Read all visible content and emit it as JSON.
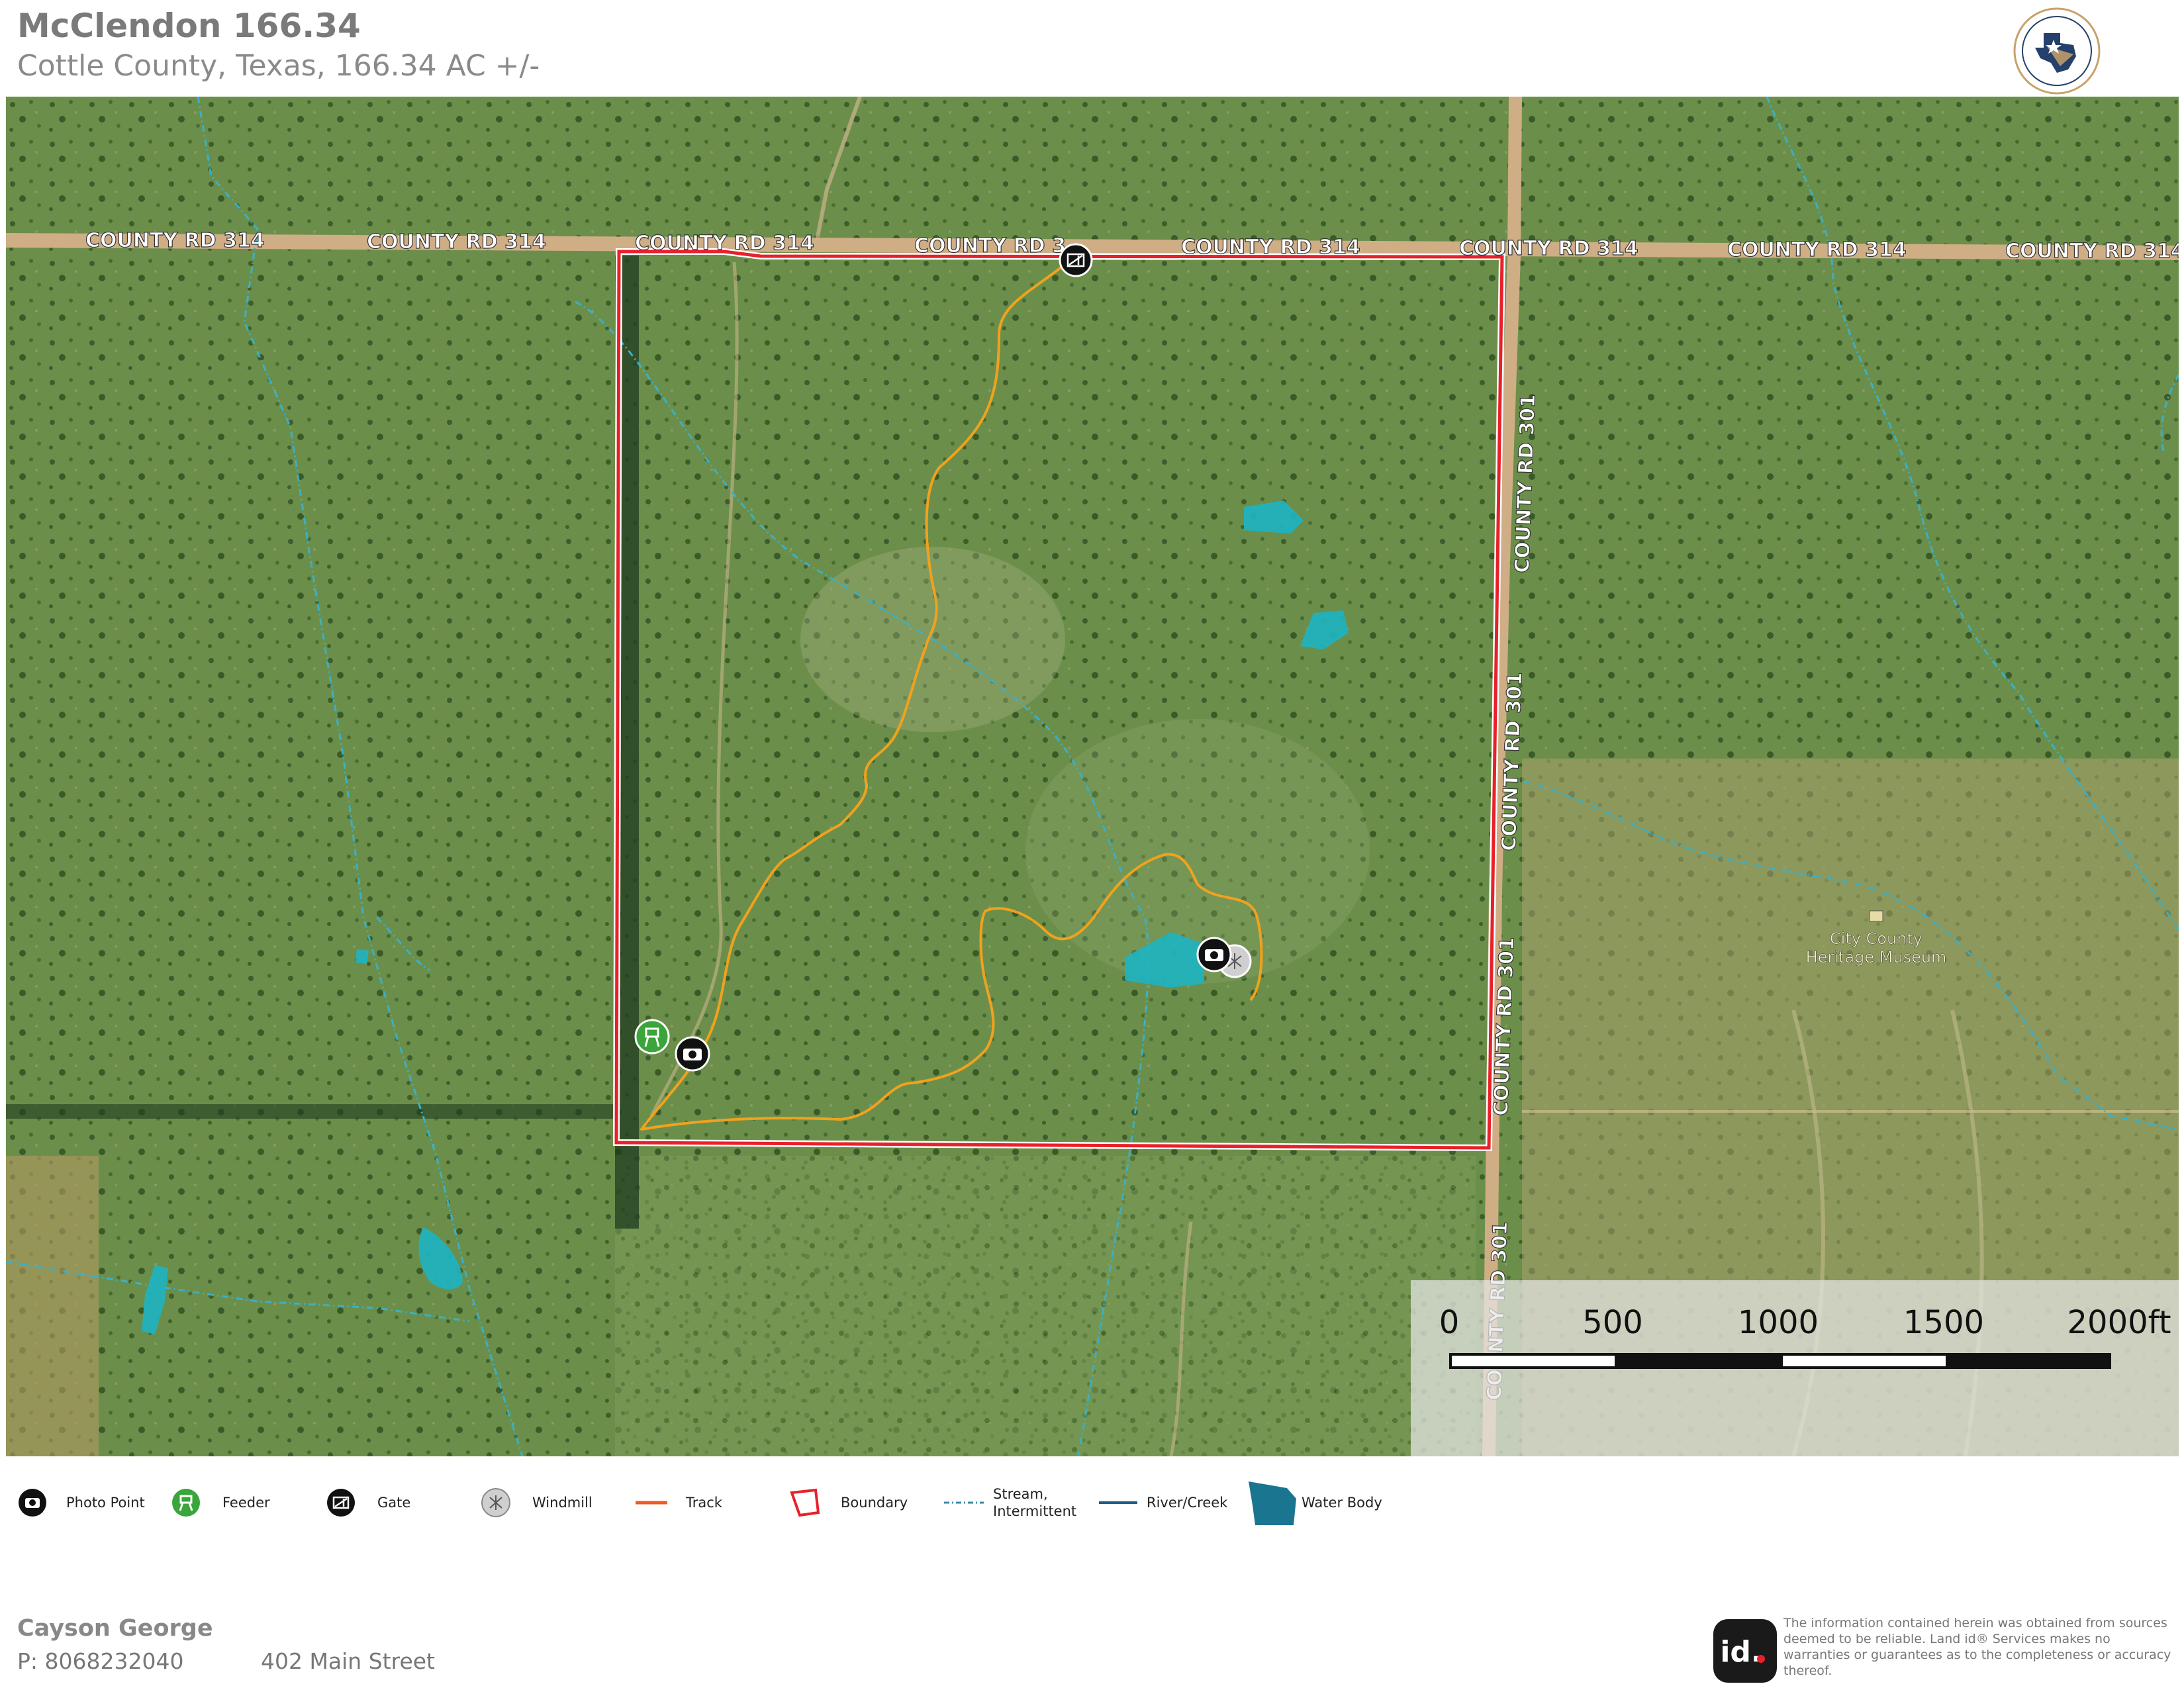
{
  "header": {
    "title": "McClendon 166.34",
    "subtitle": "Cottle County, Texas, 166.34 AC +/-"
  },
  "logo": {
    "name": "western-heritage-logo",
    "text": "WESTERN HERITAGE REALTY & INVESTMENTS"
  },
  "map": {
    "roads": {
      "county_rd_314": "COUNTY RD 314",
      "county_rd_314_partial": "COUNTY RD 3",
      "county_rd_301": "COUNTY RD 301"
    },
    "poi": {
      "museum_line1": "City County",
      "museum_line2": "Heritage Museum"
    },
    "colors": {
      "boundary": "#e8202a",
      "track": "#f0a21e",
      "stream": "#3ab0c8",
      "water": "#1fb3c0",
      "feeder": "#3aa53a"
    }
  },
  "scale_bar": {
    "labels": [
      "0",
      "500",
      "1000",
      "1500",
      "2000ft"
    ]
  },
  "legend": {
    "photo_point": "Photo Point",
    "feeder": "Feeder",
    "gate": "Gate",
    "windmill": "Windmill",
    "track": "Track",
    "boundary": "Boundary",
    "stream_line1": "Stream,",
    "stream_line2": "Intermittent",
    "river": "River/Creek",
    "water_body": "Water Body"
  },
  "agent": {
    "name": "Cayson George",
    "phone": "P: 8068232040",
    "address": "402 Main Street"
  },
  "disclaimer": {
    "logo_text": "id.",
    "text": "The information contained herein was obtained from sources deemed to be reliable. Land id® Services makes no warranties or guarantees as to the completeness or accuracy thereof."
  }
}
